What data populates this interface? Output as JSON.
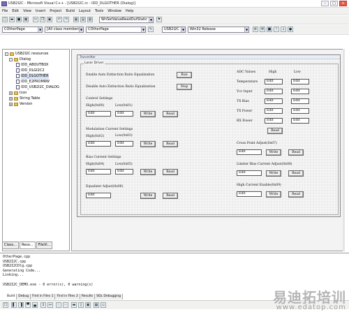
{
  "window": {
    "title": "USB2I2C - Microsoft Visual C++ - [USB2I2C.rc - IDD_DLGOTHER (Dialog)]"
  },
  "menu": [
    "File",
    "Edit",
    "View",
    "Insert",
    "Project",
    "Build",
    "Layout",
    "Tools",
    "Window",
    "Help"
  ],
  "toolbar1": {
    "find_combo": "WnSetValueReadOutStatic"
  },
  "toolbar2": {
    "class_combo": "COtherPage",
    "members_combo": "[All class members]",
    "function_combo": "COtherPage",
    "project_combo": "USB2I2C",
    "config_combo": "Win32 Release"
  },
  "tree": {
    "root": "USB2I2C resources",
    "dialog": "Dialog",
    "dialogs": [
      "IDD_ABOUTBOX",
      "IDD_DLGI2C2",
      "IDD_DLGOTHER",
      "IDD_E2PROMRW",
      "IDD_USB2I2C_DIALOG"
    ],
    "others": [
      "Icon",
      "String Table",
      "Version"
    ]
  },
  "left_tabs": [
    "Class...",
    "Reso...",
    "FileVi..."
  ],
  "dialog": {
    "title": "Transmitter",
    "laser_group": "Laser Driver",
    "enable_auto": "Enable Auto Extinction Ratio Equalization",
    "disable_auto": "Disable Auto Extinction Ratio Equalization",
    "run_btn": "Run",
    "stop_btn": "Stop",
    "control_settings": "Control Settings",
    "high_0x00": "High(0x00)",
    "low_0x01": "Low(0x01)",
    "modulation": "Modulation Current Settings",
    "high_0x02": "High(0x02)",
    "low_0x03": "Low(0x03)",
    "bias": "Bias Current Settings",
    "high_0x04": "High(0x04)",
    "low_0x05": "Low(0x05)",
    "equalizer": "Equalizer Adjust(0x06)",
    "edit": "Edit",
    "write": "Write",
    "read": "Read",
    "adc_values": "ADC Values",
    "high": "High",
    "low": "Low",
    "adc_rows": [
      "Temperature",
      "Vcc Input",
      "TX Bias",
      "TX Power",
      "RX Power"
    ],
    "cross_point": "Cross Point Adjust(0x07)",
    "limiter_bias": "Limiter Bias Current Adjust(0x08)",
    "high_current_enable": "High Current Enable(0x09)"
  },
  "output": {
    "lines": [
      "OtherPage.cpp",
      "USB2I2C.cpp",
      "USB2I2CDlg.cpp",
      "Generating Code...",
      "Linking...",
      "",
      "USB2I2C_DEMO.exe - 0 error(s), 0 warning(s)"
    ],
    "tabs": [
      "Build",
      "Debug",
      "Find in Files 1",
      "Find in Files 2",
      "Results",
      "SQL Debugging"
    ]
  },
  "watermark": {
    "cn": "易迪拓培训",
    "url": "www.edatop.com"
  }
}
